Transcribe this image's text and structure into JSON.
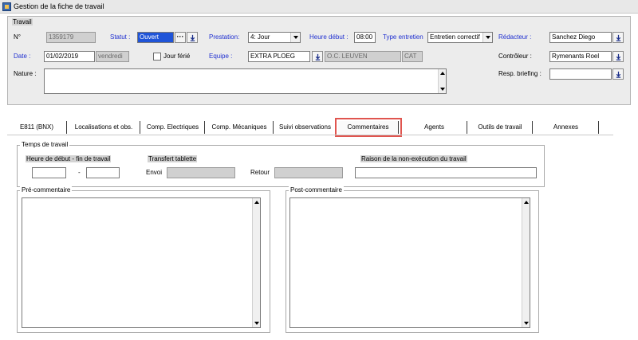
{
  "window": {
    "title": "Gestion de la fiche de travail"
  },
  "travail": {
    "group_label": "Travail",
    "no_label": "N°",
    "no_value": "1359179",
    "statut_label": "Statut :",
    "statut_value": "Ouvert",
    "prestation_label": "Prestation:",
    "prestation_value": "4: Jour",
    "heure_debut_label": "Heure début :",
    "heure_debut_value": "08:00",
    "type_entretien_label": "Type entretien",
    "type_entretien_value": "Entretien correctif",
    "redacteur_label": "Rédacteur :",
    "redacteur_value": "Sanchez Diego",
    "date_label": "Date :",
    "date_value": "01/02/2019",
    "day_value": "vendredi",
    "jour_ferie_label": "Jour férié",
    "equipe_label": "Equipe :",
    "equipe_value": "EXTRA PLOEG",
    "location_value": "O.C. LEUVEN",
    "cat_value": "CAT",
    "controleur_label": "Contrôleur :",
    "controleur_value": "Rymenants Roel",
    "nature_label": "Nature :",
    "resp_briefing_label": "Resp. briefing :"
  },
  "tabs": [
    {
      "label": "E811 (BNX)"
    },
    {
      "label": "Localisations et obs."
    },
    {
      "label": "Comp. Electriques"
    },
    {
      "label": "Comp. Mécaniques"
    },
    {
      "label": "Suivi observations"
    },
    {
      "label": "Commentaires"
    },
    {
      "label": "Agents"
    },
    {
      "label": "Outils de travail"
    },
    {
      "label": "Annexes"
    }
  ],
  "temps": {
    "group_label": "Temps de travail",
    "heure_label": "Heure de début - fin de travail",
    "dash": "-",
    "transfert_label": "Transfert tablette",
    "envoi_label": "Envoi",
    "retour_label": "Retour",
    "raison_label": "Raison de la non-exécution du travail"
  },
  "pre_commentaire": {
    "label": "Pré-commentaire"
  },
  "post_commentaire": {
    "label": "Post-commentaire"
  },
  "colors": {
    "label_blue": "#1f2fd0",
    "selection_blue": "#1f54d8",
    "highlight_red": "#e0554f",
    "panel_bg": "#ececec"
  }
}
